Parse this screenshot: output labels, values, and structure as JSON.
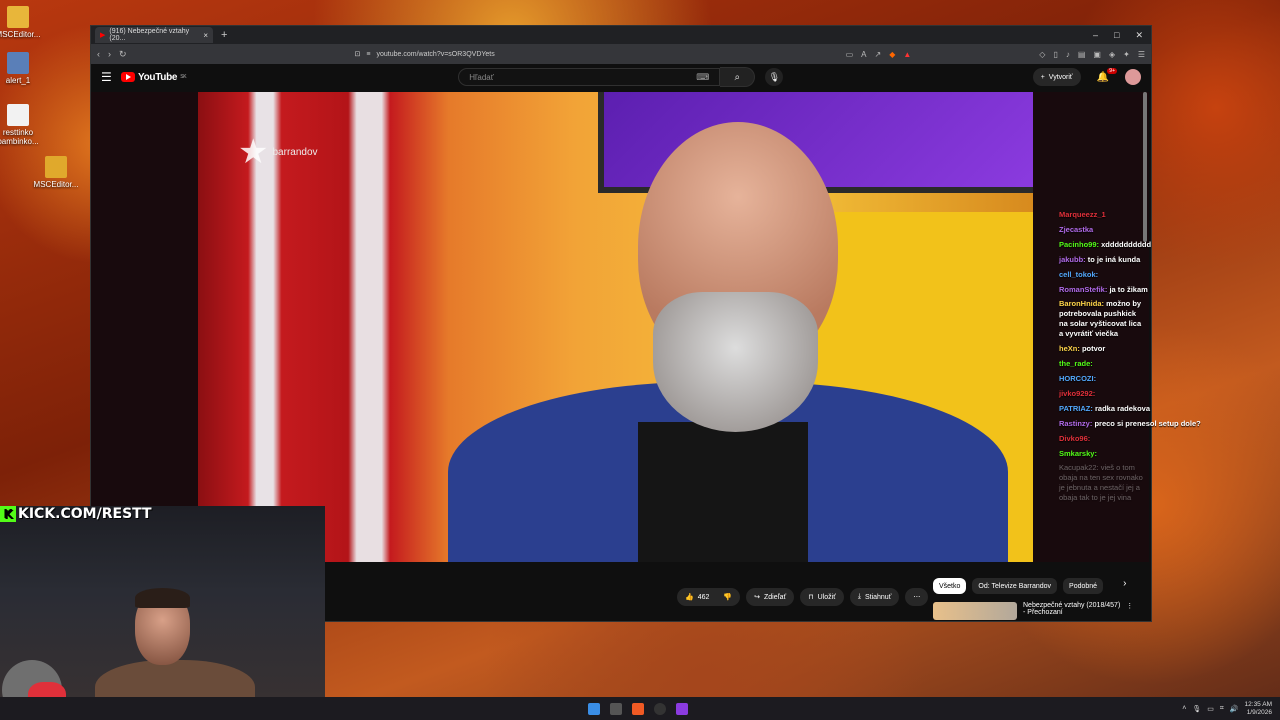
{
  "desktop": {
    "icons": [
      {
        "label": "MSCEditor..."
      },
      {
        "label": "alert_1"
      },
      {
        "label": "resttinko bambinko..."
      },
      {
        "label": "MSCEditor..."
      }
    ]
  },
  "browser": {
    "tab": {
      "title": "(916) Nebezpečné vztahy (20..."
    },
    "new_tab": "+",
    "url": "youtube.com/watch?v=sOR3QVDYets"
  },
  "youtube": {
    "logo": "YouTube",
    "region": "SK",
    "search_placeholder": "Hľadať",
    "create_label": "Vytvoriť",
    "notif_badge": "9+",
    "channel_watermark": "barrandov",
    "actions": {
      "likes": "462",
      "share": "Zdieľať",
      "save": "Uložiť",
      "download": "Stiahnuť"
    },
    "chips": [
      {
        "label": "Všetko",
        "active": true
      },
      {
        "label": "Od: Televize Barrandov",
        "active": false
      },
      {
        "label": "Podobné",
        "active": false
      }
    ],
    "related": [
      {
        "title": "Nebezpečné vztahy (2018/457)",
        "subtitle": "- Přechozaní"
      }
    ]
  },
  "chat": {
    "messages": [
      {
        "user": "Marqueezz_1 ",
        "text": "",
        "color": "#e0303a"
      },
      {
        "user": "Zjecastka",
        "text": "",
        "color": "#b06ae8"
      },
      {
        "user": "Pacinho99:",
        "text": "xdddddddddd",
        "color": "#53fc18"
      },
      {
        "user": "jakubb:",
        "text": "to je iná kunda",
        "color": "#b06ae8"
      },
      {
        "user": "cell_tokok:",
        "text": "",
        "color": "#53a8fc"
      },
      {
        "user": "RomanStefik:",
        "text": "ja to žikam",
        "color": "#b06ae8"
      },
      {
        "user": "BaronHnida:",
        "text": "možno by potrebovala pushkick na solar vyšticovat lica a vyvrátiť viečka",
        "color": "#ffd54a",
        "wrap": true
      },
      {
        "user": "heXn:",
        "text": "potvor",
        "color": "#ffd54a"
      },
      {
        "user": "the_rade:",
        "text": "",
        "color": "#53fc18"
      },
      {
        "user": "HORCOZI:",
        "text": "",
        "color": "#53a8fc"
      },
      {
        "user": "jivko9292:",
        "text": "",
        "color": "#e0303a"
      },
      {
        "user": "PATRIAZ:",
        "text": "radka radekova",
        "color": "#53a8fc"
      },
      {
        "user": "Rastinzy:",
        "text": "preco si prenesol setup dole?",
        "color": "#b06ae8"
      },
      {
        "user": "Divko96:",
        "text": "",
        "color": "#e0303a"
      },
      {
        "user": "Smkarsky:",
        "text": "",
        "color": "#53fc18"
      },
      {
        "user": "Kacupak22:",
        "text": "vieš o tom obaja na ten sex rovnako je jebnuta a nestačí jej a obaja tak to je jej vina",
        "color": "#ffffff",
        "wrap": true,
        "dim": true
      }
    ]
  },
  "stream_overlay": {
    "kick_label": "KICK.COM/RESTT"
  },
  "taskbar": {
    "time": "12:35 AM",
    "date": "1/9/2026"
  }
}
